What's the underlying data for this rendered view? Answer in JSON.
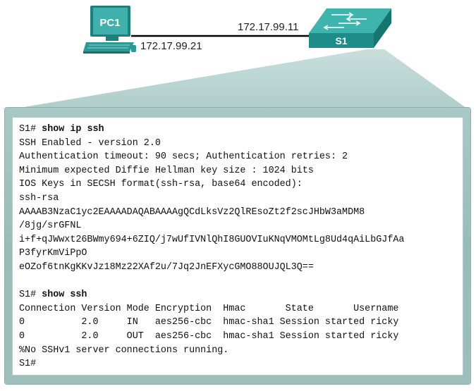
{
  "diagram": {
    "pc_label": "PC1",
    "switch_label": "S1",
    "switch_ip": "172.17.99.11",
    "pc_ip": "172.17.99.21"
  },
  "colors": {
    "device_teal": "#2a9a97",
    "device_teal_dark": "#1d7a76",
    "link": "#000000",
    "callout": "#a9c9c6"
  },
  "terminal": {
    "lines": [
      {
        "prompt": "S1# ",
        "command": "show ip ssh"
      },
      {
        "text": "SSH Enabled - version 2.0"
      },
      {
        "text": "Authentication timeout: 90 secs; Authentication retries: 2"
      },
      {
        "text": "Minimum expected Diffie Hellman key size : 1024 bits"
      },
      {
        "text": "IOS Keys in SECSH format(ssh-rsa, base64 encoded):"
      },
      {
        "text": "ssh-rsa"
      },
      {
        "text": "AAAAB3NzaC1yc2EAAAADAQABAAAAgQCdLksVz2QlREsoZt2f2scJHbW3aMDM8"
      },
      {
        "text": "/8jg/srGFNL"
      },
      {
        "text": "i+f+qJWwxt26BWmy694+6ZIQ/j7wUfIVNlQhI8GUOVIuKNqVMOMtLg8Ud4qAiLbGJfAa"
      },
      {
        "text": "P3fyrKmViPpO"
      },
      {
        "text": "eOZof6tnKgKKvJz18Mz22XAf2u/7Jq2JnEFXycGMO88OUJQL3Q=="
      },
      {
        "text": ""
      },
      {
        "prompt": "S1# ",
        "command": "show ssh"
      },
      {
        "text": "Connection Version Mode Encryption  Hmac       State       Username"
      },
      {
        "text": "0          2.0     IN   aes256-cbc  hmac-sha1 Session started ricky"
      },
      {
        "text": "0          2.0     OUT  aes256-cbc  hmac-sha1 Session started ricky"
      },
      {
        "text": "%No SSHv1 server connections running."
      },
      {
        "prompt": "S1#",
        "command": ""
      }
    ]
  }
}
